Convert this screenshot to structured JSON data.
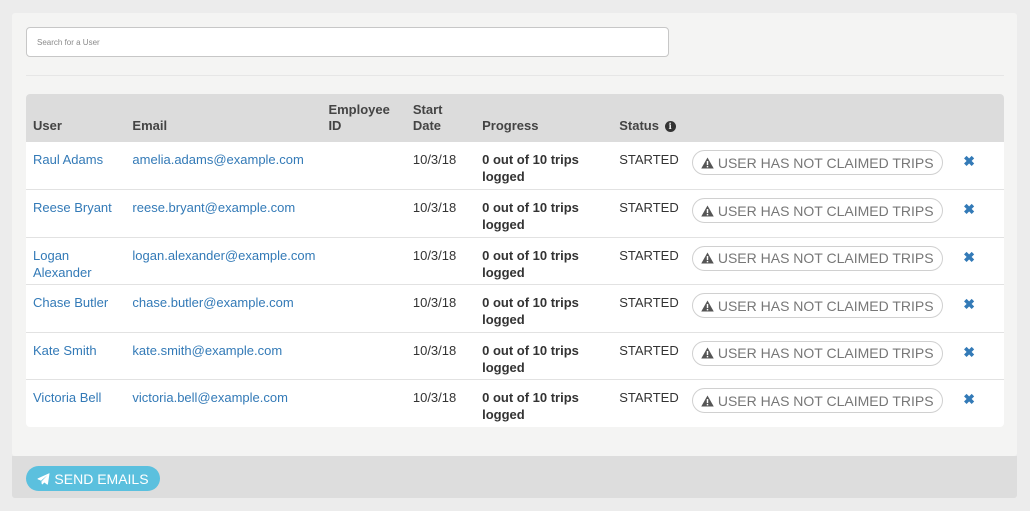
{
  "search": {
    "placeholder": "Search for a User",
    "value": ""
  },
  "table": {
    "headers": {
      "user": "User",
      "email": "Email",
      "employee_id": "Employee ID",
      "start_date": "Start Date",
      "progress": "Progress",
      "status": "Status"
    },
    "rows": [
      {
        "user": "Raul Adams",
        "email": "amelia.adams@example.com",
        "employee_id": "",
        "start_date": "10/3/18",
        "progress": "0 out of 10 trips logged",
        "status": "STARTED",
        "action": "USER HAS NOT CLAIMED TRIPS"
      },
      {
        "user": "Reese Bryant",
        "email": "reese.bryant@example.com",
        "employee_id": "",
        "start_date": "10/3/18",
        "progress": "0 out of 10 trips logged",
        "status": "STARTED",
        "action": "USER HAS NOT CLAIMED TRIPS"
      },
      {
        "user": "Logan Alexander",
        "email": "logan.alexander@example.com",
        "employee_id": "",
        "start_date": "10/3/18",
        "progress": "0 out of 10 trips logged",
        "status": "STARTED",
        "action": "USER HAS NOT CLAIMED TRIPS"
      },
      {
        "user": "Chase Butler",
        "email": "chase.butler@example.com",
        "employee_id": "",
        "start_date": "10/3/18",
        "progress": "0 out of 10 trips logged",
        "status": "STARTED",
        "action": "USER HAS NOT CLAIMED TRIPS"
      },
      {
        "user": "Kate Smith",
        "email": "kate.smith@example.com",
        "employee_id": "",
        "start_date": "10/3/18",
        "progress": "0 out of 10 trips logged",
        "status": "STARTED",
        "action": "USER HAS NOT CLAIMED TRIPS"
      },
      {
        "user": "Victoria Bell",
        "email": "victoria.bell@example.com",
        "employee_id": "",
        "start_date": "10/3/18",
        "progress": "0 out of 10 trips logged",
        "status": "STARTED",
        "action": "USER HAS NOT CLAIMED TRIPS"
      }
    ]
  },
  "footer": {
    "send_label": "SEND EMAILS"
  },
  "icons": {
    "status_info": "info-circle-icon",
    "warning": "warning-triangle-icon",
    "remove": "close-icon",
    "send": "paper-plane-icon"
  },
  "colors": {
    "link": "#337ab7",
    "send_button": "#5bc0de",
    "header_bg": "#dcdcdc"
  }
}
